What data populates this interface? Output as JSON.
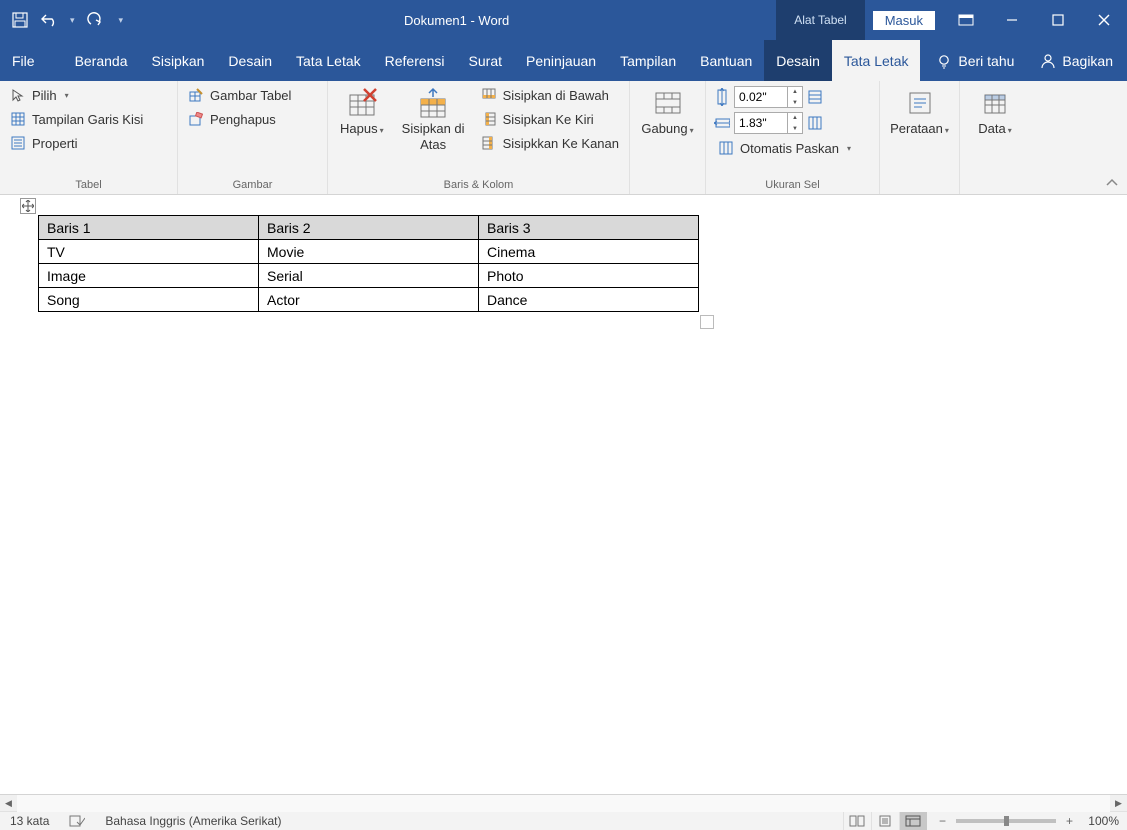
{
  "title": "Dokumen1  -  Word",
  "context_tab": "Alat Tabel",
  "login": "Masuk",
  "tabs": {
    "file": "File",
    "home": "Beranda",
    "insert": "Sisipkan",
    "design": "Desain",
    "layout": "Tata Letak",
    "references": "Referensi",
    "mailings": "Surat",
    "review": "Peninjauan",
    "view": "Tampilan",
    "help": "Bantuan",
    "tdesign": "Desain",
    "tlayout": "Tata Letak"
  },
  "tellme": "Beri tahu",
  "share": "Bagikan",
  "ribbon": {
    "tabel": {
      "select": "Pilih",
      "gridlines": "Tampilan Garis Kisi",
      "properties": "Properti",
      "label": "Tabel"
    },
    "gambar": {
      "draw": "Gambar Tabel",
      "eraser": "Penghapus",
      "label": "Gambar"
    },
    "rowscols": {
      "delete": "Hapus",
      "insert_above": "Sisipkan di Atas",
      "insert_below": "Sisipkan di Bawah",
      "insert_left": "Sisipkan Ke Kiri",
      "insert_right": "Sisipkkan Ke Kanan",
      "label": "Baris & Kolom"
    },
    "merge": {
      "merge": "Gabung",
      "label": ""
    },
    "cellsize": {
      "height": "0.02\"",
      "width": "1.83\"",
      "autofit": "Otomatis Paskan",
      "label": "Ukuran Sel"
    },
    "align": {
      "label": "Perataan"
    },
    "data": {
      "label": "Data"
    }
  },
  "table": {
    "headers": [
      "Baris 1",
      "Baris 2",
      "Baris 3"
    ],
    "rows": [
      [
        "TV",
        "Movie",
        "Cinema"
      ],
      [
        "Image",
        "Serial",
        "Photo"
      ],
      [
        "Song",
        "Actor",
        "Dance"
      ]
    ]
  },
  "status": {
    "words": "13 kata",
    "lang": "Bahasa Inggris (Amerika Serikat)",
    "zoom": "100%"
  }
}
